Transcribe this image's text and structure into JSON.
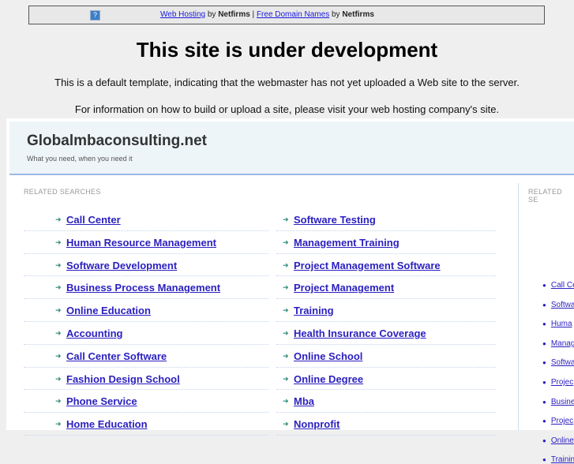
{
  "topbar": {
    "web_hosting": "Web Hosting",
    "by1": " by ",
    "netfirms1": "Netfirms",
    "sep": " | ",
    "free_domain": "Free Domain Names",
    "by2": " by ",
    "netfirms2": "Netfirms"
  },
  "title": "This site is under development",
  "para1": "This is a default template, indicating that the webmaster has not yet uploaded a Web site to the server.",
  "para2": "For information on how to build or upload a site, please visit your web hosting company's site.",
  "site": {
    "name": "Globalmbaconsulting.net",
    "tagline": "What you need, when you need it"
  },
  "related_label": "RELATED SEARCHES",
  "related_label_side": "RELATED SE",
  "left_links": [
    "Call Center",
    "Human Resource Management",
    "Software Development",
    "Business Process Management",
    "Online Education",
    "Accounting",
    "Call Center Software",
    "Fashion Design School",
    "Phone Service",
    "Home Education"
  ],
  "right_links": [
    "Software Testing",
    "Management Training",
    "Project Management Software",
    "Project Management",
    "Training",
    "Health Insurance Coverage",
    "Online School",
    "Online Degree",
    "Mba",
    "Nonprofit"
  ],
  "side_links": [
    "Call Ce",
    "Softwa",
    "Huma",
    "Manag",
    "Softwa",
    "Projec",
    "Busine",
    "Projec",
    "Online",
    "Trainin"
  ]
}
